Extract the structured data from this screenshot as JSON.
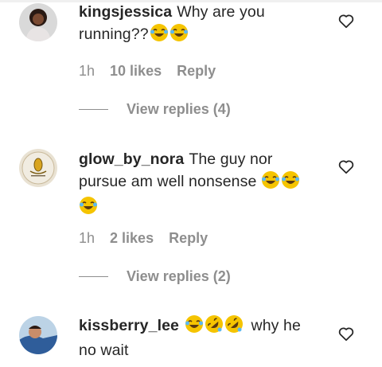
{
  "comments": [
    {
      "username": "kingsjessica",
      "text": "Why are you running??",
      "emojis": [
        "joy",
        "joy"
      ],
      "time": "1h",
      "likes": "10 likes",
      "reply_label": "Reply",
      "view_replies": "View replies (4)"
    },
    {
      "username": "glow_by_nora",
      "text": "The guy nor pursue am well nonsense",
      "emojis": [
        "joy",
        "joy",
        "joy"
      ],
      "time": "1h",
      "likes": "2 likes",
      "reply_label": "Reply",
      "view_replies": "View replies (2)"
    },
    {
      "username": "kissberry_lee",
      "emojis": [
        "joy",
        "rofl",
        "rofl"
      ],
      "text": "why he no wait"
    }
  ],
  "icons": {
    "like": "heart-outline-icon",
    "joy": "face-with-tears-of-joy-emoji",
    "rofl": "rolling-on-floor-laughing-emoji"
  },
  "colors": {
    "text": "#262626",
    "muted": "#8e8e8e",
    "emoji": "#f5c400"
  }
}
